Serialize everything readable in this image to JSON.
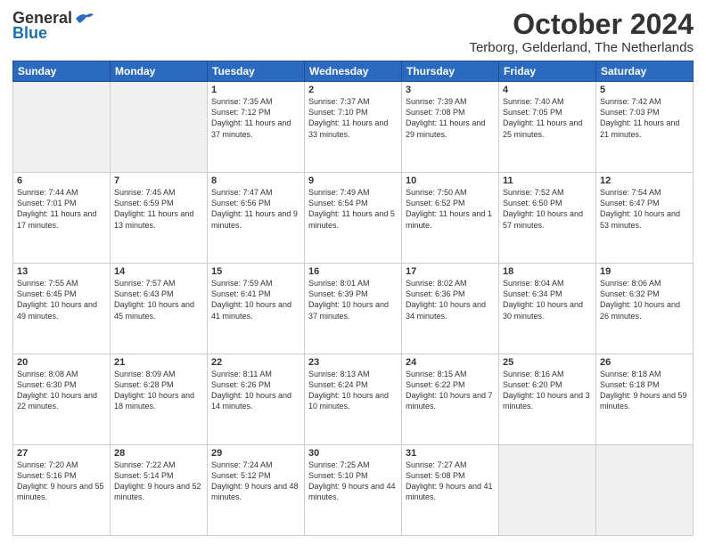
{
  "header": {
    "logo": {
      "general": "General",
      "blue": "Blue"
    },
    "title": "October 2024",
    "subtitle": "Terborg, Gelderland, The Netherlands"
  },
  "calendar": {
    "weekdays": [
      "Sunday",
      "Monday",
      "Tuesday",
      "Wednesday",
      "Thursday",
      "Friday",
      "Saturday"
    ],
    "weeks": [
      [
        {
          "day": "",
          "empty": true
        },
        {
          "day": "",
          "empty": true
        },
        {
          "day": "1",
          "sunrise": "7:35 AM",
          "sunset": "7:12 PM",
          "daylight": "11 hours and 37 minutes."
        },
        {
          "day": "2",
          "sunrise": "7:37 AM",
          "sunset": "7:10 PM",
          "daylight": "11 hours and 33 minutes."
        },
        {
          "day": "3",
          "sunrise": "7:39 AM",
          "sunset": "7:08 PM",
          "daylight": "11 hours and 29 minutes."
        },
        {
          "day": "4",
          "sunrise": "7:40 AM",
          "sunset": "7:05 PM",
          "daylight": "11 hours and 25 minutes."
        },
        {
          "day": "5",
          "sunrise": "7:42 AM",
          "sunset": "7:03 PM",
          "daylight": "11 hours and 21 minutes."
        }
      ],
      [
        {
          "day": "6",
          "sunrise": "7:44 AM",
          "sunset": "7:01 PM",
          "daylight": "11 hours and 17 minutes."
        },
        {
          "day": "7",
          "sunrise": "7:45 AM",
          "sunset": "6:59 PM",
          "daylight": "11 hours and 13 minutes."
        },
        {
          "day": "8",
          "sunrise": "7:47 AM",
          "sunset": "6:56 PM",
          "daylight": "11 hours and 9 minutes."
        },
        {
          "day": "9",
          "sunrise": "7:49 AM",
          "sunset": "6:54 PM",
          "daylight": "11 hours and 5 minutes."
        },
        {
          "day": "10",
          "sunrise": "7:50 AM",
          "sunset": "6:52 PM",
          "daylight": "11 hours and 1 minute."
        },
        {
          "day": "11",
          "sunrise": "7:52 AM",
          "sunset": "6:50 PM",
          "daylight": "10 hours and 57 minutes."
        },
        {
          "day": "12",
          "sunrise": "7:54 AM",
          "sunset": "6:47 PM",
          "daylight": "10 hours and 53 minutes."
        }
      ],
      [
        {
          "day": "13",
          "sunrise": "7:55 AM",
          "sunset": "6:45 PM",
          "daylight": "10 hours and 49 minutes."
        },
        {
          "day": "14",
          "sunrise": "7:57 AM",
          "sunset": "6:43 PM",
          "daylight": "10 hours and 45 minutes."
        },
        {
          "day": "15",
          "sunrise": "7:59 AM",
          "sunset": "6:41 PM",
          "daylight": "10 hours and 41 minutes."
        },
        {
          "day": "16",
          "sunrise": "8:01 AM",
          "sunset": "6:39 PM",
          "daylight": "10 hours and 37 minutes."
        },
        {
          "day": "17",
          "sunrise": "8:02 AM",
          "sunset": "6:36 PM",
          "daylight": "10 hours and 34 minutes."
        },
        {
          "day": "18",
          "sunrise": "8:04 AM",
          "sunset": "6:34 PM",
          "daylight": "10 hours and 30 minutes."
        },
        {
          "day": "19",
          "sunrise": "8:06 AM",
          "sunset": "6:32 PM",
          "daylight": "10 hours and 26 minutes."
        }
      ],
      [
        {
          "day": "20",
          "sunrise": "8:08 AM",
          "sunset": "6:30 PM",
          "daylight": "10 hours and 22 minutes."
        },
        {
          "day": "21",
          "sunrise": "8:09 AM",
          "sunset": "6:28 PM",
          "daylight": "10 hours and 18 minutes."
        },
        {
          "day": "22",
          "sunrise": "8:11 AM",
          "sunset": "6:26 PM",
          "daylight": "10 hours and 14 minutes."
        },
        {
          "day": "23",
          "sunrise": "8:13 AM",
          "sunset": "6:24 PM",
          "daylight": "10 hours and 10 minutes."
        },
        {
          "day": "24",
          "sunrise": "8:15 AM",
          "sunset": "6:22 PM",
          "daylight": "10 hours and 7 minutes."
        },
        {
          "day": "25",
          "sunrise": "8:16 AM",
          "sunset": "6:20 PM",
          "daylight": "10 hours and 3 minutes."
        },
        {
          "day": "26",
          "sunrise": "8:18 AM",
          "sunset": "6:18 PM",
          "daylight": "9 hours and 59 minutes."
        }
      ],
      [
        {
          "day": "27",
          "sunrise": "7:20 AM",
          "sunset": "5:16 PM",
          "daylight": "9 hours and 55 minutes."
        },
        {
          "day": "28",
          "sunrise": "7:22 AM",
          "sunset": "5:14 PM",
          "daylight": "9 hours and 52 minutes."
        },
        {
          "day": "29",
          "sunrise": "7:24 AM",
          "sunset": "5:12 PM",
          "daylight": "9 hours and 48 minutes."
        },
        {
          "day": "30",
          "sunrise": "7:25 AM",
          "sunset": "5:10 PM",
          "daylight": "9 hours and 44 minutes."
        },
        {
          "day": "31",
          "sunrise": "7:27 AM",
          "sunset": "5:08 PM",
          "daylight": "9 hours and 41 minutes."
        },
        {
          "day": "",
          "empty": true
        },
        {
          "day": "",
          "empty": true
        }
      ]
    ]
  }
}
